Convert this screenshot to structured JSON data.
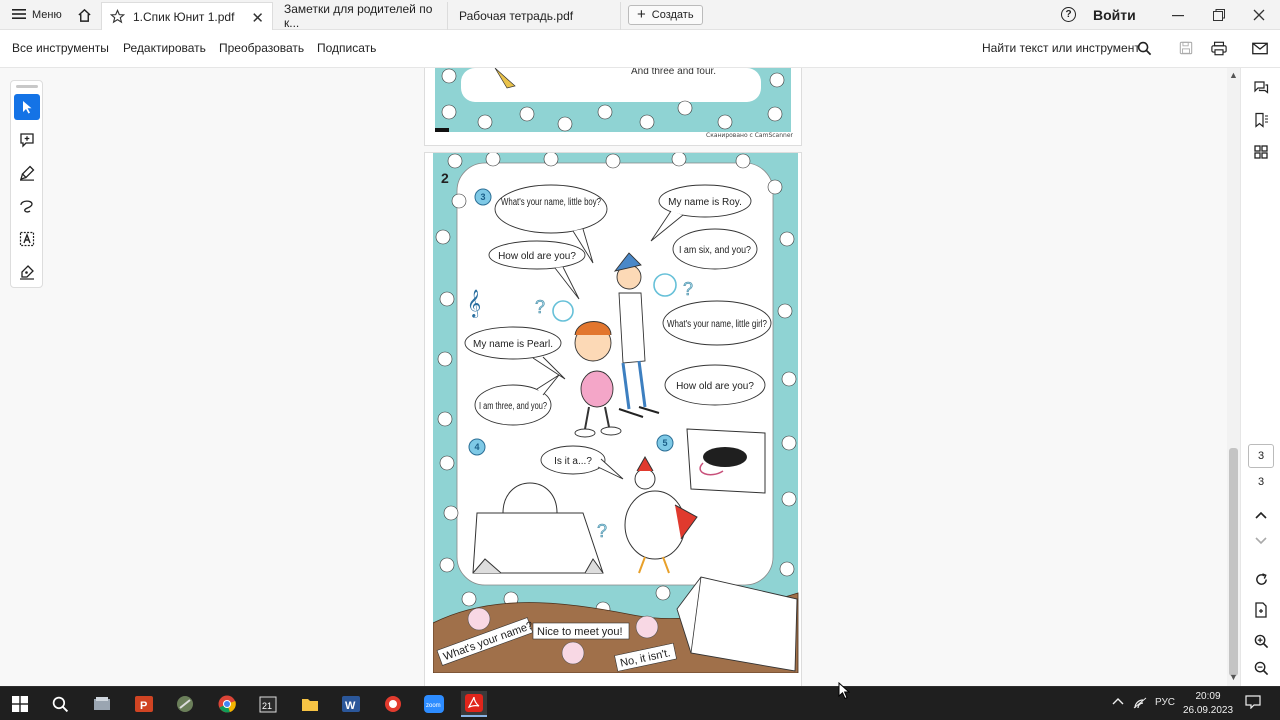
{
  "titlebar": {
    "menu_label": "Меню",
    "tabs": [
      {
        "label": "1.Спик Юнит 1.pdf",
        "active": true
      },
      {
        "label": "Заметки для родителей по к..."
      },
      {
        "label": "Рабочая тетрадь.pdf"
      }
    ],
    "new_tab_label": "Создать",
    "signin_label": "Войти",
    "controls": [
      "minimize-icon",
      "restore-icon",
      "close-icon"
    ]
  },
  "toolbar": {
    "items": [
      "Все инструменты",
      "Редактировать",
      "Преобразовать",
      "Подписать"
    ],
    "search_label": "Найти текст или инструмент"
  },
  "left_tools": [
    "select-icon",
    "add-comment-icon",
    "highlight-icon",
    "draw-freeform-icon",
    "text-box-icon",
    "fill-sign-icon"
  ],
  "document": {
    "scanned_note": "Сканировано с CamScanner",
    "page_number_label": "2",
    "top_page_text": "And three and four.",
    "bubbles": [
      "What's your name, little boy?",
      "My name is Roy.",
      "How old are you?",
      "I am six, and you?",
      "What's your name, little girl?",
      "My name is Pearl.",
      "How old are you?",
      "I am three, and you?",
      "Is it a...?"
    ],
    "badges": [
      "3",
      "4",
      "5"
    ],
    "bottom_phrases": [
      "What's your name?",
      "Nice to meet you!",
      "No, it isn't."
    ]
  },
  "right_rail": {
    "current_page": "3",
    "total_pages": "3"
  },
  "taskbar": {
    "apps": [
      "windows-start-icon",
      "search-icon",
      "file-manager-icon",
      "powerpoint-icon",
      "ccleaner-icon",
      "chrome-icon",
      "calendar-icon",
      "folder-icon",
      "word-icon",
      "yandex-icon",
      "zoom-icon",
      "acrobat-icon"
    ],
    "language": "РУС",
    "time": "20:09",
    "date": "26.09.2023"
  }
}
